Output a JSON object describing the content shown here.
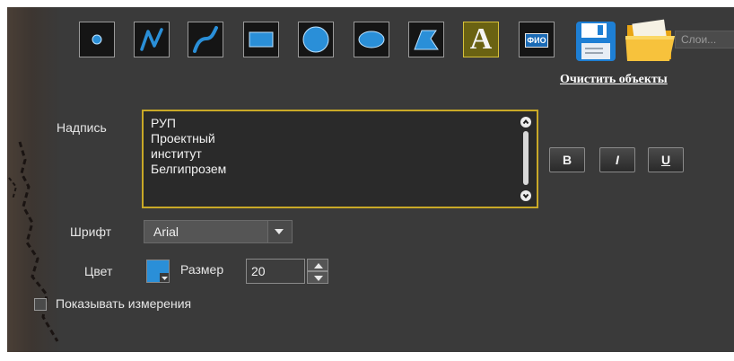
{
  "toolbar": {
    "tools": [
      {
        "name": "point-tool",
        "icon": "point-icon"
      },
      {
        "name": "polyline-tool",
        "icon": "polyline-icon"
      },
      {
        "name": "curve-tool",
        "icon": "curve-icon"
      },
      {
        "name": "rectangle-tool",
        "icon": "rectangle-icon"
      },
      {
        "name": "circle-tool",
        "icon": "circle-icon"
      },
      {
        "name": "ellipse-tool",
        "icon": "ellipse-icon"
      },
      {
        "name": "polygon-tool",
        "icon": "polygon-icon"
      },
      {
        "name": "text-tool",
        "icon": "text-icon",
        "glyph": "A",
        "active": true
      },
      {
        "name": "fio-tool",
        "icon": "fio-icon",
        "glyph": "ФИО"
      }
    ],
    "save_icon": "floppy-disk-icon",
    "open_icon": "folder-icon",
    "layers_placeholder": "Слои...",
    "clear_label": "Очистить объекты"
  },
  "form": {
    "caption_label": "Надпись",
    "caption_lines": [
      "РУП",
      "Проектный",
      "институт",
      "Белгипрозем"
    ],
    "bold_label": "B",
    "italic_label": "I",
    "underline_label": "U",
    "font_label": "Шрифт",
    "font_value": "Arial",
    "color_label": "Цвет",
    "color_value": "#2a8fd8",
    "size_label": "Размер",
    "size_value": "20",
    "show_measurements_label": "Показывать измерения",
    "show_measurements_checked": false
  },
  "colors": {
    "panel_bg": "#3a3a3a",
    "accent_border": "#c9a927",
    "tool_icon": "#2a8fd8"
  }
}
